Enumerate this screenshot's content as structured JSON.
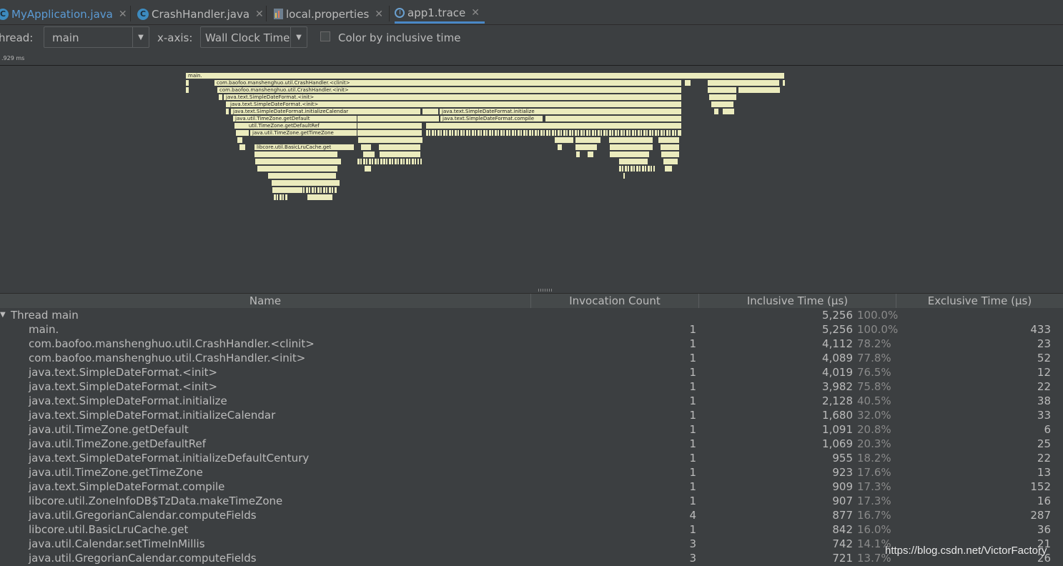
{
  "tabs": [
    {
      "label": "MyApplication.java",
      "icon": "java-class-icon",
      "active": false
    },
    {
      "label": "CrashHandler.java",
      "icon": "java-class-icon",
      "active": false
    },
    {
      "label": "local.properties",
      "icon": "properties-file-icon",
      "active": false
    },
    {
      "label": "app1.trace",
      "icon": "trace-file-icon",
      "active": true
    }
  ],
  "toolbar": {
    "thread_label": "hread:",
    "thread_value": "main",
    "xaxis_label": "x-axis:",
    "xaxis_value": "Wall Clock Time",
    "color_checkbox_label": "Color by inclusive time",
    "color_checkbox_checked": false
  },
  "ruler": {
    "label": ".929 ms"
  },
  "flame_labels": [
    "main.",
    "com.baofoo.manshenghuo.util.CrashHandler.<clinit>",
    "com.baofoo.manshenghuo.util.CrashHandler.<init>",
    "java.text.SimpleDateFormat.<init>",
    "java.text.SimpleDateFormat.<init>",
    "java.text.SimpleDateFormat.initializeCalendar",
    "java.text.SimpleDateFormat.initialize",
    "java.util.TimeZone.getDefault",
    "java.text.SimpleDateFormat.compile",
    "java.util.TimeZone.getDefaultRef",
    "java.util.TimeZone.getTimeZone",
    "libcore.util.BasicLruCache.get"
  ],
  "table": {
    "columns": [
      "Name",
      "Invocation Count",
      "Inclusive Time (µs)",
      "Exclusive Time (µs)"
    ],
    "thread_row": {
      "name": "Thread main",
      "inclusive": "5,256",
      "pct": "100.0%"
    },
    "rows": [
      {
        "name": "main.",
        "count": "1",
        "inclusive": "5,256",
        "pct": "100.0%",
        "exclusive": "433"
      },
      {
        "name": "com.baofoo.manshenghuo.util.CrashHandler.<clinit>",
        "count": "1",
        "inclusive": "4,112",
        "pct": "78.2%",
        "exclusive": "23"
      },
      {
        "name": "com.baofoo.manshenghuo.util.CrashHandler.<init>",
        "count": "1",
        "inclusive": "4,089",
        "pct": "77.8%",
        "exclusive": "52"
      },
      {
        "name": "java.text.SimpleDateFormat.<init>",
        "count": "1",
        "inclusive": "4,019",
        "pct": "76.5%",
        "exclusive": "12"
      },
      {
        "name": "java.text.SimpleDateFormat.<init>",
        "count": "1",
        "inclusive": "3,982",
        "pct": "75.8%",
        "exclusive": "22"
      },
      {
        "name": "java.text.SimpleDateFormat.initialize",
        "count": "1",
        "inclusive": "2,128",
        "pct": "40.5%",
        "exclusive": "38"
      },
      {
        "name": "java.text.SimpleDateFormat.initializeCalendar",
        "count": "1",
        "inclusive": "1,680",
        "pct": "32.0%",
        "exclusive": "33"
      },
      {
        "name": "java.util.TimeZone.getDefault",
        "count": "1",
        "inclusive": "1,091",
        "pct": "20.8%",
        "exclusive": "6"
      },
      {
        "name": "java.util.TimeZone.getDefaultRef",
        "count": "1",
        "inclusive": "1,069",
        "pct": "20.3%",
        "exclusive": "25"
      },
      {
        "name": "java.text.SimpleDateFormat.initializeDefaultCentury",
        "count": "1",
        "inclusive": "955",
        "pct": "18.2%",
        "exclusive": "22"
      },
      {
        "name": "java.util.TimeZone.getTimeZone",
        "count": "1",
        "inclusive": "923",
        "pct": "17.6%",
        "exclusive": "13"
      },
      {
        "name": "java.text.SimpleDateFormat.compile",
        "count": "1",
        "inclusive": "909",
        "pct": "17.3%",
        "exclusive": "152"
      },
      {
        "name": "libcore.util.ZoneInfoDB$TzData.makeTimeZone",
        "count": "1",
        "inclusive": "907",
        "pct": "17.3%",
        "exclusive": "16"
      },
      {
        "name": "java.util.GregorianCalendar.computeFields",
        "count": "4",
        "inclusive": "877",
        "pct": "16.7%",
        "exclusive": "287"
      },
      {
        "name": "libcore.util.BasicLruCache.get",
        "count": "1",
        "inclusive": "842",
        "pct": "16.0%",
        "exclusive": "36"
      },
      {
        "name": "java.util.Calendar.setTimeInMillis",
        "count": "3",
        "inclusive": "742",
        "pct": "14.1%",
        "exclusive": "21"
      },
      {
        "name": "java.util.GregorianCalendar.computeFields",
        "count": "3",
        "inclusive": "721",
        "pct": "13.7%",
        "exclusive": "26"
      }
    ]
  },
  "watermark": "https://blog.csdn.net/VictorFactory"
}
